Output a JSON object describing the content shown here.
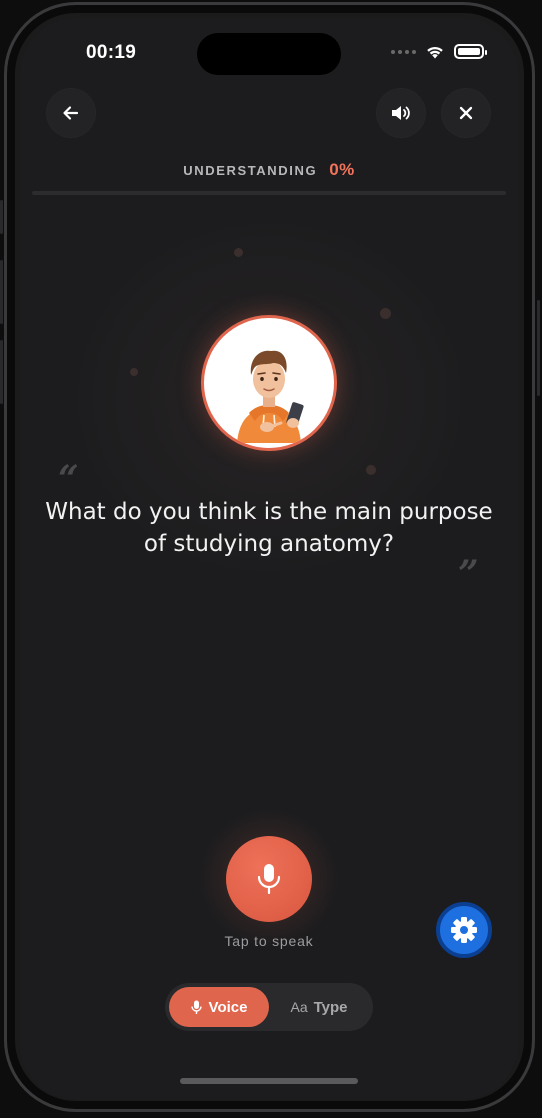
{
  "status_bar": {
    "time": "00:19"
  },
  "header": {
    "progress_label": "UNDERSTANDING",
    "progress_value": "0%",
    "progress_fraction": 0
  },
  "question": {
    "text": "What do you think is the main purpose of studying anatomy?"
  },
  "mic": {
    "hint": "Tap to speak"
  },
  "mode": {
    "voice_label": "Voice",
    "type_icon": "Aa",
    "type_label": "Type",
    "selected": "voice"
  },
  "icons": {
    "back": "arrow-left-icon",
    "sound": "speaker-icon",
    "close": "close-icon",
    "mic": "microphone-icon",
    "settings": "gear-icon"
  },
  "colors": {
    "accent": "#e0654d",
    "accent_text": "#f0735a",
    "fab": "#1e6fe0",
    "background": "#1c1c1e"
  }
}
